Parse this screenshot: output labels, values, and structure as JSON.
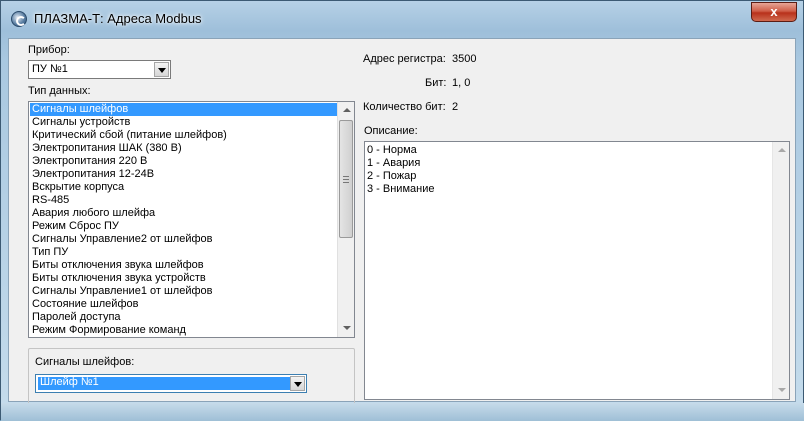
{
  "window": {
    "title": "ПЛАЗМА-Т: Адреса Modbus",
    "close_label": "x"
  },
  "device": {
    "label": "Прибор:",
    "selected": "ПУ №1"
  },
  "data_type": {
    "label": "Тип данных:",
    "items": [
      "Сигналы шлейфов",
      "Сигналы устройств",
      "Критический сбой (питание шлейфов)",
      "Электропитания ШАК (380 В)",
      "Электропитания 220 В",
      "Электропитания 12-24В",
      "Вскрытие корпуса",
      "RS-485",
      "Авария любого шлейфа",
      "Режим Сброс ПУ",
      "Сигналы Управление2 от шлейфов",
      "Тип ПУ",
      "Биты отключения звука шлейфов",
      "Биты отключения звука устройств",
      "Сигналы Управление1 от шлейфов",
      "Состояние шлейфов",
      "Паролей доступа",
      "Режим Формирование команд"
    ],
    "selected_index": 0
  },
  "sub_group": {
    "label": "Сигналы шлейфов:",
    "selected": "Шлейф №1"
  },
  "register": {
    "address_label": "Адрес регистра:",
    "address_value": "3500",
    "bit_label": "Бит:",
    "bit_value": "1, 0",
    "count_label": "Количество бит:",
    "count_value": "2"
  },
  "description": {
    "label": "Описание:",
    "lines": [
      "0 - Норма",
      "1 - Авария",
      "2 - Пожар",
      "3 - Внимание"
    ]
  },
  "colors": {
    "selection": "#3399ff",
    "close_button": "#c7442e",
    "window_frame": "#a9c8e0"
  }
}
